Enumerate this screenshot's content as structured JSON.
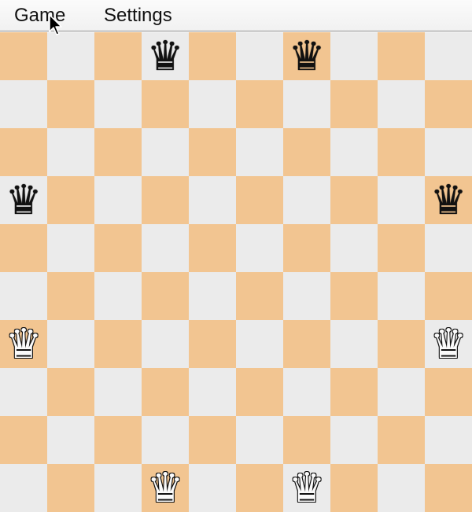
{
  "menu": {
    "game_label": "Game",
    "settings_label": "Settings"
  },
  "board": {
    "columns": 10,
    "rows": 10,
    "top_left_color": "dark",
    "colors": {
      "light": "#ebebeb",
      "dark": "#f2c591"
    },
    "pieces": [
      {
        "row": 0,
        "col": 3,
        "piece": "queen",
        "color": "black",
        "glyph": "♛"
      },
      {
        "row": 0,
        "col": 6,
        "piece": "queen",
        "color": "black",
        "glyph": "♛"
      },
      {
        "row": 3,
        "col": 0,
        "piece": "queen",
        "color": "black",
        "glyph": "♛"
      },
      {
        "row": 3,
        "col": 9,
        "piece": "queen",
        "color": "black",
        "glyph": "♛"
      },
      {
        "row": 6,
        "col": 0,
        "piece": "queen",
        "color": "white",
        "glyph": "♛"
      },
      {
        "row": 6,
        "col": 9,
        "piece": "queen",
        "color": "white",
        "glyph": "♛"
      },
      {
        "row": 9,
        "col": 3,
        "piece": "queen",
        "color": "white",
        "glyph": "♛"
      },
      {
        "row": 9,
        "col": 6,
        "piece": "queen",
        "color": "white",
        "glyph": "♛"
      }
    ]
  },
  "cursor_icon": "arrow-cursor-icon"
}
